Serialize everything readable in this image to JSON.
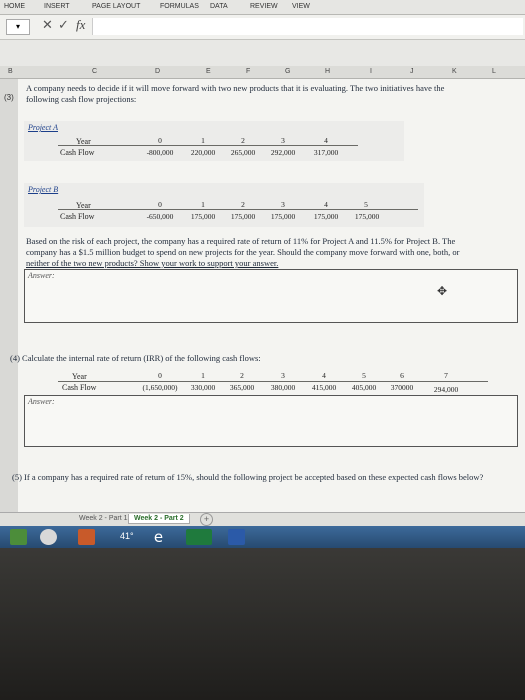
{
  "ribbon": {
    "tabs": [
      "HOME",
      "INSERT",
      "PAGE LAYOUT",
      "FORMULAS",
      "DATA",
      "REVIEW",
      "VIEW"
    ]
  },
  "formula_bar": {
    "cancel_glyph": "✕",
    "confirm_glyph": "✓",
    "fx_label": "fx",
    "value": ""
  },
  "columns": [
    "B",
    "C",
    "D",
    "E",
    "F",
    "G",
    "H",
    "I",
    "J",
    "K",
    "L"
  ],
  "q3": {
    "number": "(3)",
    "intro_line1": "A company needs to decide if it will move forward with two new products that it is evaluating. The two initiatives have the",
    "intro_line2": "following cash flow projections:",
    "project_a": {
      "title": "Project A",
      "year_label": "Year",
      "cf_label": "Cash Flow",
      "years": [
        "0",
        "1",
        "2",
        "3",
        "4"
      ],
      "flows": [
        "-800,000",
        "220,000",
        "265,000",
        "292,000",
        "317,000"
      ]
    },
    "project_b": {
      "title": "Project B",
      "year_label": "Year",
      "cf_label": "Cash Flow",
      "years": [
        "0",
        "1",
        "2",
        "3",
        "4",
        "5"
      ],
      "flows": [
        "-650,000",
        "175,000",
        "175,000",
        "175,000",
        "175,000",
        "175,000"
      ]
    },
    "text_line1": "Based on the risk of each project, the company has a required rate of return of 11% for Project A and 11.5% for Project B. The",
    "text_line2": "company has a $1.5 million budget to spend on new projects for the year. Should the company move forward with one, both, or",
    "text_line3": "neither of the two new products? Show your work to support your answer.",
    "answer_label": "Answer:"
  },
  "q4": {
    "prompt": "(4) Calculate the internal rate of return (IRR) of the following cash flows:",
    "year_label": "Year",
    "cf_label": "Cash Flow",
    "years": [
      "0",
      "1",
      "2",
      "3",
      "4",
      "5",
      "6",
      "7"
    ],
    "flows": [
      "(1,650,000)",
      "330,000",
      "365,000",
      "380,000",
      "415,000",
      "405,000",
      "370000",
      "294,000"
    ],
    "answer_label": "Answer:"
  },
  "q5": {
    "prompt": "(5) If a company has a required rate of return of 15%, should the following project be accepted based on these expected cash flows below?"
  },
  "sheet_tabs": {
    "items": [
      "Week 2 - Part 1",
      "Week 2 - Part 2"
    ],
    "active_index": 1,
    "add_glyph": "+"
  },
  "taskbar": {
    "temperature": "41°"
  }
}
